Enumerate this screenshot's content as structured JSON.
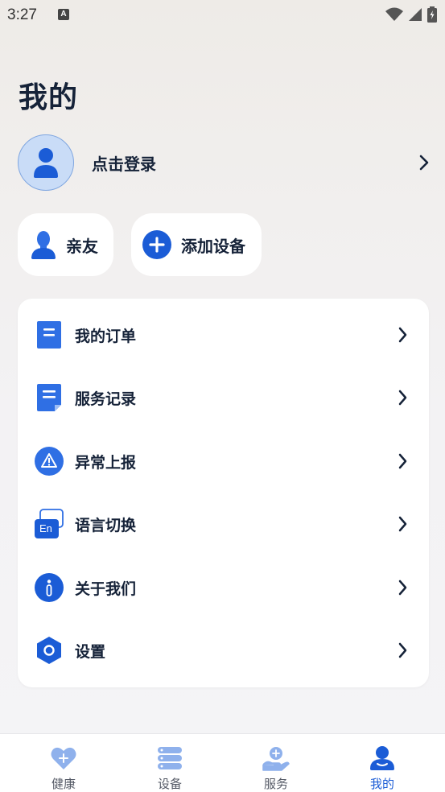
{
  "status_bar": {
    "time": "3:27",
    "notification_icon": "A"
  },
  "header": {
    "title": "我的"
  },
  "profile": {
    "login_label": "点击登录"
  },
  "quick_actions": [
    {
      "label": "亲友",
      "icon": "family-person-icon"
    },
    {
      "label": "添加设备",
      "icon": "plus-circle-icon"
    }
  ],
  "menu": [
    {
      "label": "我的订单",
      "icon": "order-document-icon"
    },
    {
      "label": "服务记录",
      "icon": "service-record-icon"
    },
    {
      "label": "异常上报",
      "icon": "warning-icon"
    },
    {
      "label": "语言切换",
      "icon": "language-switch-icon",
      "icon_text": "En"
    },
    {
      "label": "关于我们",
      "icon": "info-icon"
    },
    {
      "label": "设置",
      "icon": "settings-hexagon-icon"
    }
  ],
  "tabs": [
    {
      "label": "健康",
      "icon": "heart-plus-icon",
      "active": false
    },
    {
      "label": "设备",
      "icon": "device-stack-icon",
      "active": false
    },
    {
      "label": "服务",
      "icon": "service-hand-icon",
      "active": false
    },
    {
      "label": "我的",
      "icon": "profile-icon",
      "active": true
    }
  ],
  "colors": {
    "accent": "#1b5cd6",
    "icon_blue": "#2f6fe4",
    "text": "#152238",
    "inactive_tab": "#555a66"
  }
}
